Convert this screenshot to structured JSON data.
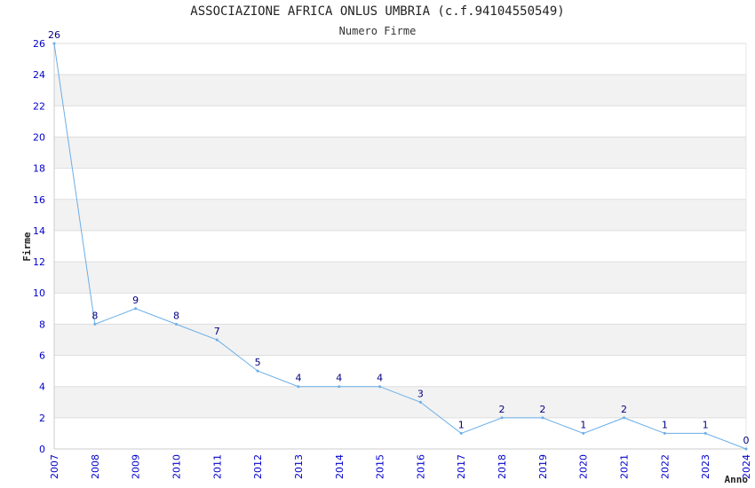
{
  "chart_data": {
    "type": "line",
    "title": "ASSOCIAZIONE AFRICA ONLUS UMBRIA (c.f.94104550549)",
    "subtitle": "Numero Firme",
    "xlabel": "Anno",
    "ylabel": "Firme",
    "categories": [
      "2007",
      "2008",
      "2009",
      "2010",
      "2011",
      "2012",
      "2013",
      "2014",
      "2015",
      "2016",
      "2017",
      "2018",
      "2019",
      "2020",
      "2021",
      "2022",
      "2023",
      "2024"
    ],
    "values": [
      26,
      8,
      9,
      8,
      7,
      5,
      4,
      4,
      4,
      3,
      1,
      2,
      2,
      1,
      2,
      1,
      1,
      0
    ],
    "ylim": [
      0,
      26
    ],
    "yticks": [
      "0",
      "2",
      "4",
      "6",
      "8",
      "10",
      "12",
      "14",
      "16",
      "18",
      "20",
      "22",
      "24",
      "26"
    ],
    "grid": true,
    "line_color": "#6aaee8",
    "band_color": "#f2f2f2"
  }
}
